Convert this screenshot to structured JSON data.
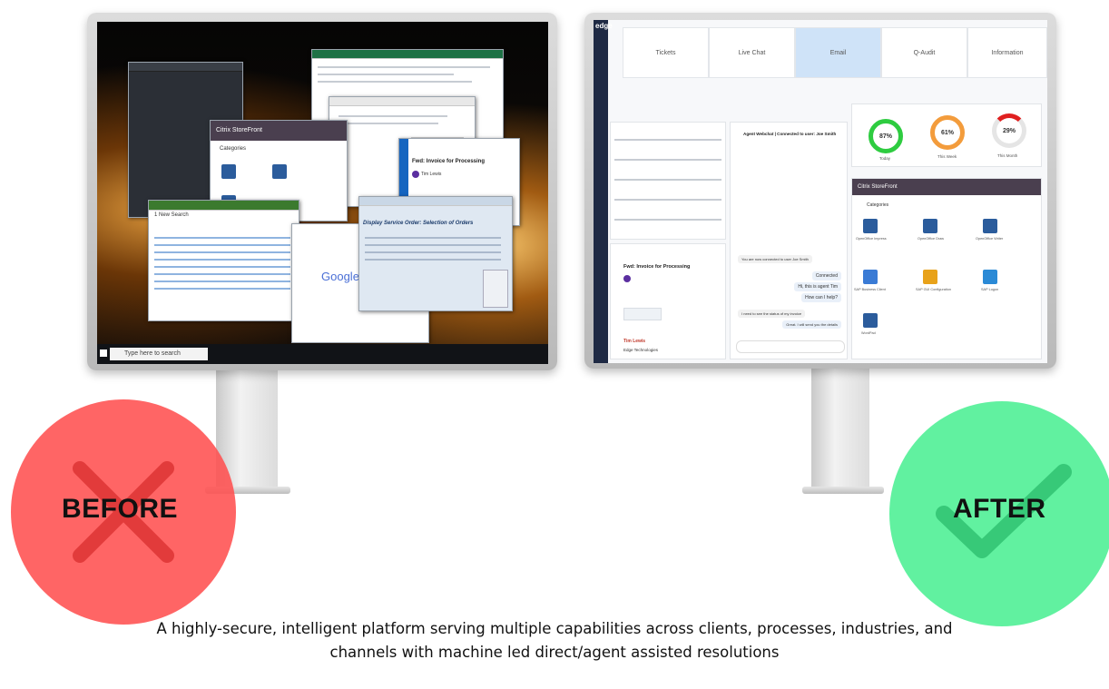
{
  "before_screen": {
    "browser_google_logo": "Google",
    "storefront_title": "Citrix StoreFront",
    "storefront_categories": "Categories",
    "email_subject": "Fwd: Invoice for Processing",
    "email_sender": "Tim Lewis",
    "sap_title": "Display Service Order: Selection of Orders",
    "search_window_title": "1 New Search",
    "taskbar_search_placeholder": "Type here to search"
  },
  "after_screen": {
    "app_logo": "edge",
    "tabs": [
      "Tickets",
      "Live Chat",
      "Email",
      "Q-Audit",
      "Information"
    ],
    "active_tab": "Email",
    "chat_header": "Agent Webchat | Connected to user: Joe Smith",
    "chat_messages": [
      "You are now connected to user Joe Smith",
      "Connected",
      "Hi, this is agent Tim",
      "How can I help?",
      "I need to see the status of my invoice",
      "Great. I will send you the details"
    ],
    "email_subject": "Fwd: Invoice for Processing",
    "email_signature_name": "Tim Lewis",
    "email_signature_company": "Edge Technologies",
    "gauges": [
      {
        "percent": "87%",
        "label": "Today",
        "color": "#2ecc40",
        "value": 0.87
      },
      {
        "percent": "61%",
        "label": "This Week",
        "color": "#f39c3c",
        "value": 0.61
      },
      {
        "percent": "29%",
        "label": "This Month",
        "color": "#e02020",
        "value": 0.29
      }
    ],
    "storefront_title": "Citrix StoreFront",
    "storefront_categories": "Categories",
    "storefront_apps": [
      "OpenOffice Impress",
      "OpenOffice Draw",
      "OpenOffice Writer",
      "SAP Business Client",
      "SAP GUI Configuration",
      "SAP Logon",
      "WordPad"
    ]
  },
  "labels": {
    "before": "BEFORE",
    "after": "AFTER"
  },
  "colors": {
    "before_circle": "#ff5a5a",
    "before_mark": "#e23b3b",
    "after_circle": "#5ef2a0",
    "after_mark": "#37c978"
  },
  "caption": "A highly-secure, intelligent platform serving multiple capabilities across clients, processes, industries, and channels with machine led direct/agent assisted resolutions"
}
